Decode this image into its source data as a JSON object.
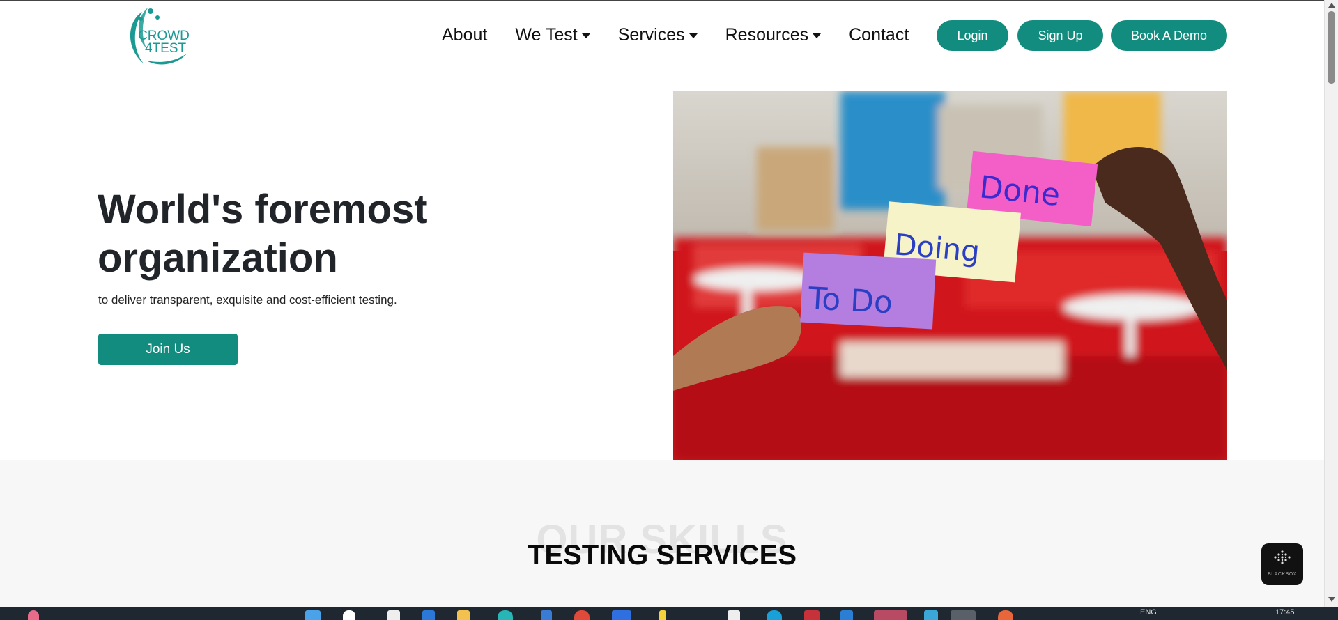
{
  "logo": {
    "line1": "CROWD",
    "line2": "4TEST"
  },
  "nav": {
    "links": [
      {
        "label": "About",
        "dropdown": false
      },
      {
        "label": "We Test",
        "dropdown": true
      },
      {
        "label": "Services",
        "dropdown": true
      },
      {
        "label": "Resources",
        "dropdown": true
      },
      {
        "label": "Contact",
        "dropdown": false
      }
    ],
    "login_label": "Login",
    "signup_label": "Sign Up",
    "demo_label": "Book A Demo"
  },
  "hero": {
    "title": "World's foremost organization",
    "subtitle": "to deliver transparent, exquisite and cost-efficient testing.",
    "cta_label": "Join Us",
    "image_notes": [
      "Done",
      "Doing",
      "To Do"
    ]
  },
  "skills": {
    "bg_title": "OUR SKILLS",
    "title": "TESTING SERVICES"
  },
  "widget": {
    "label": "BLACKBOX"
  },
  "taskbar": {
    "lang": "ENG",
    "time": "17:45"
  },
  "colors": {
    "accent": "#128c7e",
    "logo": "#1a9a93",
    "heading": "#212529"
  }
}
